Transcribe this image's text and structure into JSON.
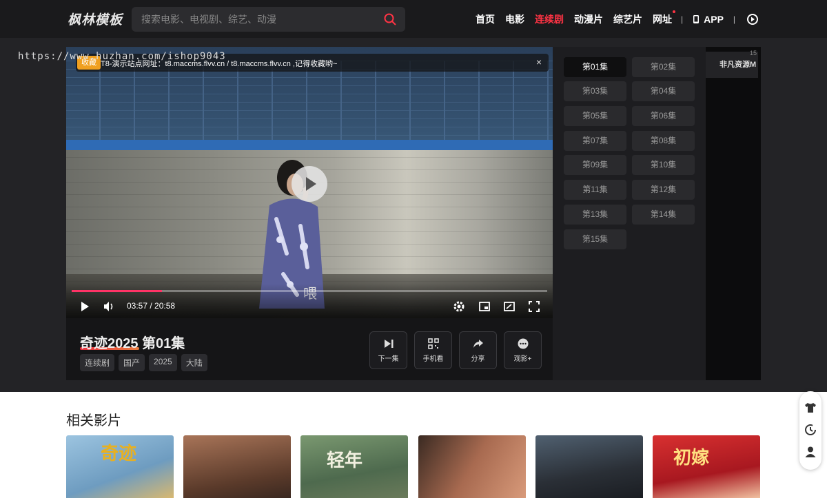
{
  "site": {
    "logo": "枫林模板"
  },
  "search": {
    "placeholder": "搜索电影、电视剧、综艺、动漫"
  },
  "nav": {
    "items": [
      {
        "label": "首页",
        "active": false
      },
      {
        "label": "电影",
        "active": false
      },
      {
        "label": "连续剧",
        "active": true
      },
      {
        "label": "动漫片",
        "active": false
      },
      {
        "label": "综艺片",
        "active": false
      },
      {
        "label": "网址",
        "active": false
      }
    ],
    "app_label": "APP"
  },
  "watermark": "https://www.huzhan.com/ishop9043",
  "player": {
    "notice_tag": "收藏",
    "notice_text": "T8-演示站点网址：t8.maccms.flvv.cn / t8.maccms.flvv.cn ,记得收藏哟~",
    "close": "×",
    "subtitle": "喂",
    "time": "03:57 / 20:58",
    "progress": 0.19
  },
  "video": {
    "title": "奇迹2025 第01集",
    "tags": [
      "连续剧",
      "国产",
      "2025",
      "大陆"
    ],
    "actions": [
      {
        "label": "下一集",
        "icon": "next-icon"
      },
      {
        "label": "手机看",
        "icon": "qrcode-icon"
      },
      {
        "label": "分享",
        "icon": "share-icon"
      },
      {
        "label": "观影+",
        "icon": "more-icon"
      }
    ]
  },
  "episodes": {
    "active": "第01集",
    "list": [
      "第01集",
      "第02集",
      "第03集",
      "第04集",
      "第05集",
      "第06集",
      "第07集",
      "第08集",
      "第09集",
      "第10集",
      "第11集",
      "第12集",
      "第13集",
      "第14集",
      "第15集"
    ]
  },
  "sources": {
    "name": "非凡资源M",
    "count": "15"
  },
  "related": {
    "title": "相关影片",
    "cards": [
      {
        "caption": "奇迹",
        "bg": "#8fb8d6",
        "fg": "#e8b020"
      },
      {
        "caption": "",
        "bg": "#6a4a38",
        "fg": "#fff"
      },
      {
        "caption": "轻年",
        "bg": "#5b7458",
        "fg": "#f2f0e0"
      },
      {
        "caption": "",
        "bg": "#8a5a46",
        "fg": "#fff"
      },
      {
        "caption": "",
        "bg": "#3a4048",
        "fg": "#fff"
      },
      {
        "caption": "初嫁",
        "bg": "#c8222a",
        "fg": "#ffe080"
      }
    ]
  },
  "colors": {
    "accent": "#ff3344",
    "progress": "#ff3366",
    "dark_bg": "#232326"
  }
}
